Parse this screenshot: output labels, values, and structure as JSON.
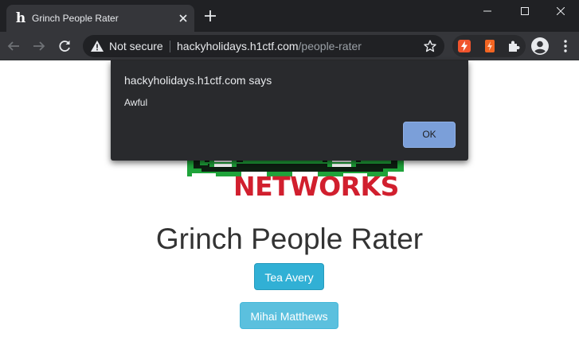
{
  "browser": {
    "tab": {
      "title": "Grinch People Rater",
      "favicon_glyph": "h"
    },
    "address_bar": {
      "security_label": "Not secure",
      "host": "hackyholidays.h1ctf.com",
      "path": "/people-rater"
    },
    "icons": {
      "tab_close": "close-icon",
      "new_tab": "plus-icon",
      "back": "arrow-left-icon",
      "forward": "arrow-right-icon",
      "reload": "reload-icon",
      "security": "warning-icon",
      "bookmark": "star-icon",
      "extensions": "puzzle-icon",
      "profile": "avatar-icon",
      "menu": "kebab-menu-icon"
    }
  },
  "page": {
    "logo_text": "NETWORKS",
    "title": "Grinch People Rater",
    "people": [
      "Tea Avery",
      "Mihai Matthews"
    ]
  },
  "dialog": {
    "title": "hackyholidays.h1ctf.com says",
    "message": "Awful",
    "ok_label": "OK"
  },
  "colors": {
    "chrome_dark": "#202124",
    "chrome_toolbar": "#35363a",
    "logo_red": "#d11f2e",
    "logo_green": "#1fa33a",
    "button_info": "#5bc0de",
    "button_info_hover": "#31b0d5",
    "dialog_ok": "#7b9fd9"
  }
}
